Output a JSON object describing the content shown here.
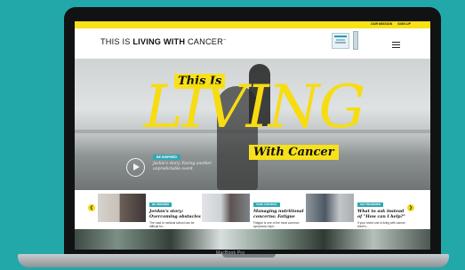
{
  "colors": {
    "background": "#23a8aa",
    "brand_yellow": "#f7e117",
    "tag_teal": "#2ea8b5"
  },
  "device": {
    "label": "MacBook Pro"
  },
  "site": {
    "top_links": [
      "OUR MISSION",
      "SIGN UP"
    ],
    "logo": {
      "part1": "THIS IS ",
      "part2": "LIVING WITH",
      "part3": " CANCER",
      "tm": "™"
    },
    "menu_icon": "hamburger-icon"
  },
  "hero": {
    "title_small": "This Is",
    "title_big": "LIVING",
    "title_tail": "With Cancer",
    "badge": "BE INSPIRED",
    "caption": "Jackie's story: Facing another unpredictable event",
    "play_icon": "play-icon"
  },
  "carousel": {
    "prev_icon": "chevron-left-icon",
    "next_icon": "chevron-right-icon",
    "cards": [
      {
        "tag": "BE INSPIRED",
        "title": "Jordan's story: Overcoming obstacles",
        "desc": "The road to medical school can be difficult for..."
      },
      {
        "tag": "TAKE CONTROL",
        "title": "Managing nutritional concerns: Fatigue",
        "desc": "Fatigue is one of the most common symptoms expe..."
      },
      {
        "tag": "GET INFORMED",
        "title": "What to ask instead of \"How can I help?\"",
        "desc": "If your loved one is living with cancer, there's..."
      }
    ]
  }
}
